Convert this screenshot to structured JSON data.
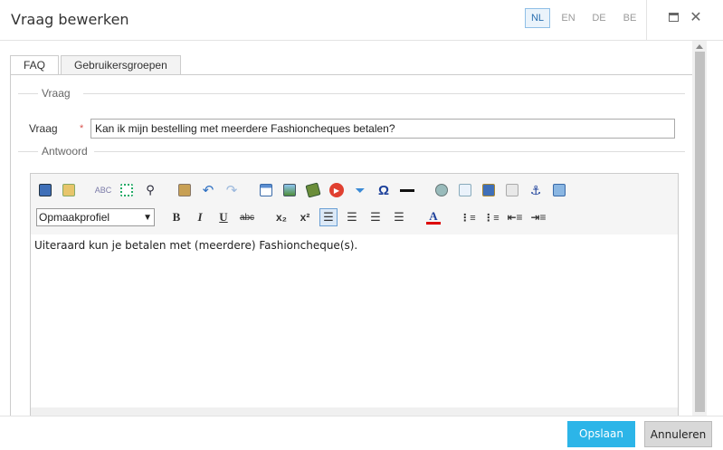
{
  "window": {
    "title": "Vraag bewerken",
    "languages": [
      "NL",
      "EN",
      "DE",
      "BE"
    ],
    "active_language": "NL"
  },
  "tabs": [
    {
      "label": "FAQ",
      "active": true
    },
    {
      "label": "Gebruikersgroepen",
      "active": false
    }
  ],
  "sections": {
    "question_legend": "Vraag",
    "answer_legend": "Antwoord"
  },
  "question": {
    "label": "Vraag",
    "required_mark": "*",
    "value": "Kan ik mijn bestelling met meerdere Fashioncheques betalen?"
  },
  "editor": {
    "style_select_value": "Opmaakprofiel",
    "content": "Uiteraard kun je betalen met (meerdere) Fashioncheque(s).",
    "format_labels": {
      "bold": "B",
      "italic": "I",
      "underline": "U",
      "strike": "abc",
      "subscript": "x₂",
      "superscript": "x²",
      "special_char": "Ω",
      "font_color": "A"
    }
  },
  "buttons": {
    "save": "Opslaan",
    "cancel": "Annuleren"
  },
  "colors": {
    "accent": "#2cb5e8",
    "active_lang": "#2a6fb0",
    "required": "#d9534f"
  }
}
